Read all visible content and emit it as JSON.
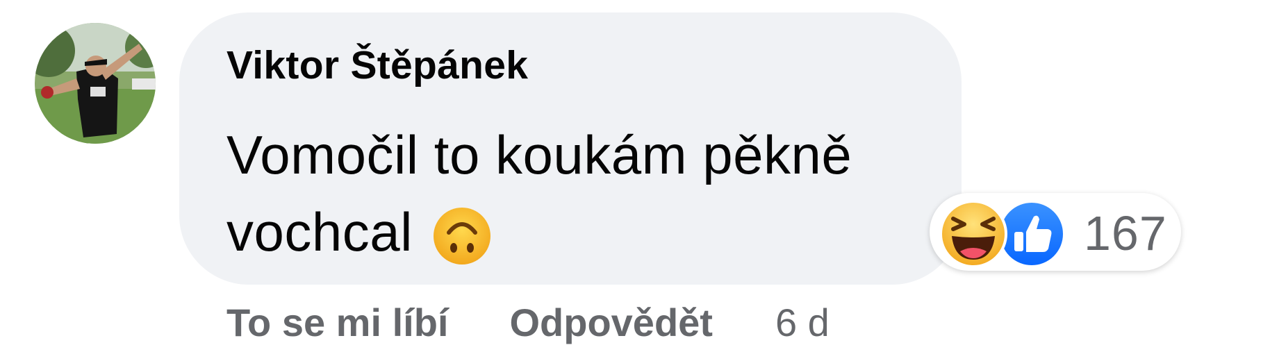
{
  "comment": {
    "author": "Viktor Štěpánek",
    "text_line1": "Vomočil to koukám pěkně",
    "text_line2": "vochcal",
    "emoji": "upside-down-face"
  },
  "reactions": {
    "icons": [
      "haha-reaction-icon",
      "like-reaction-icon"
    ],
    "count": "167"
  },
  "actions": {
    "like_label": "To se mi líbí",
    "reply_label": "Odpovědět",
    "time": "6 d"
  },
  "colors": {
    "bubble_bg": "#f0f2f5",
    "text": "#050505",
    "secondary_text": "#65676b",
    "like_blue": "#1877f2",
    "haha_yellow": "#f7b928"
  }
}
